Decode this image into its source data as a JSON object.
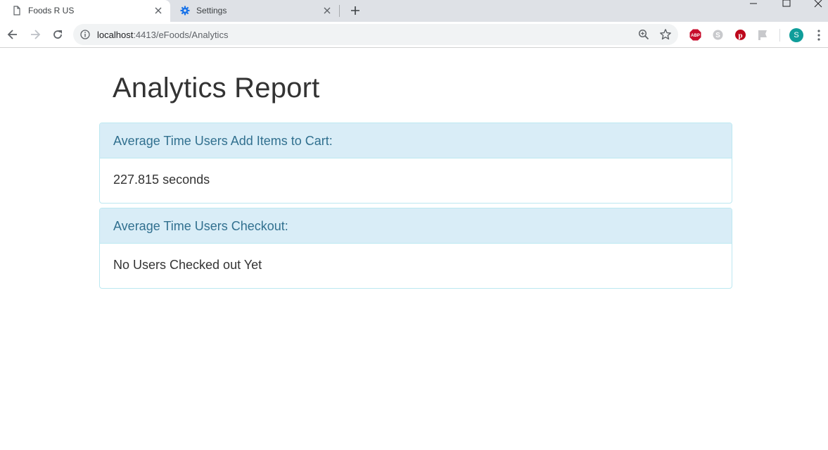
{
  "browser": {
    "tabs": [
      {
        "title": "Foods R US",
        "favicon": "page-icon"
      },
      {
        "title": "Settings",
        "favicon": "gear-icon"
      }
    ],
    "url_host": "localhost",
    "url_path": ":4413/eFoods/Analytics",
    "avatar_letter": "S",
    "colors": {
      "avatar": "#0f9d9a",
      "settings_gear": "#1a73e8",
      "adblock": "#c70d2c",
      "pinterest": "#bd081c"
    }
  },
  "page": {
    "title": "Analytics Report",
    "panels": [
      {
        "heading": "Average Time Users Add Items to Cart:",
        "value": "227.815 seconds"
      },
      {
        "heading": "Average Time Users Checkout:",
        "value": "No Users Checked out Yet"
      }
    ],
    "colors": {
      "panel_heading_bg": "#d9edf7",
      "panel_heading_text": "#31708f",
      "panel_border": "#bce8f1"
    }
  }
}
